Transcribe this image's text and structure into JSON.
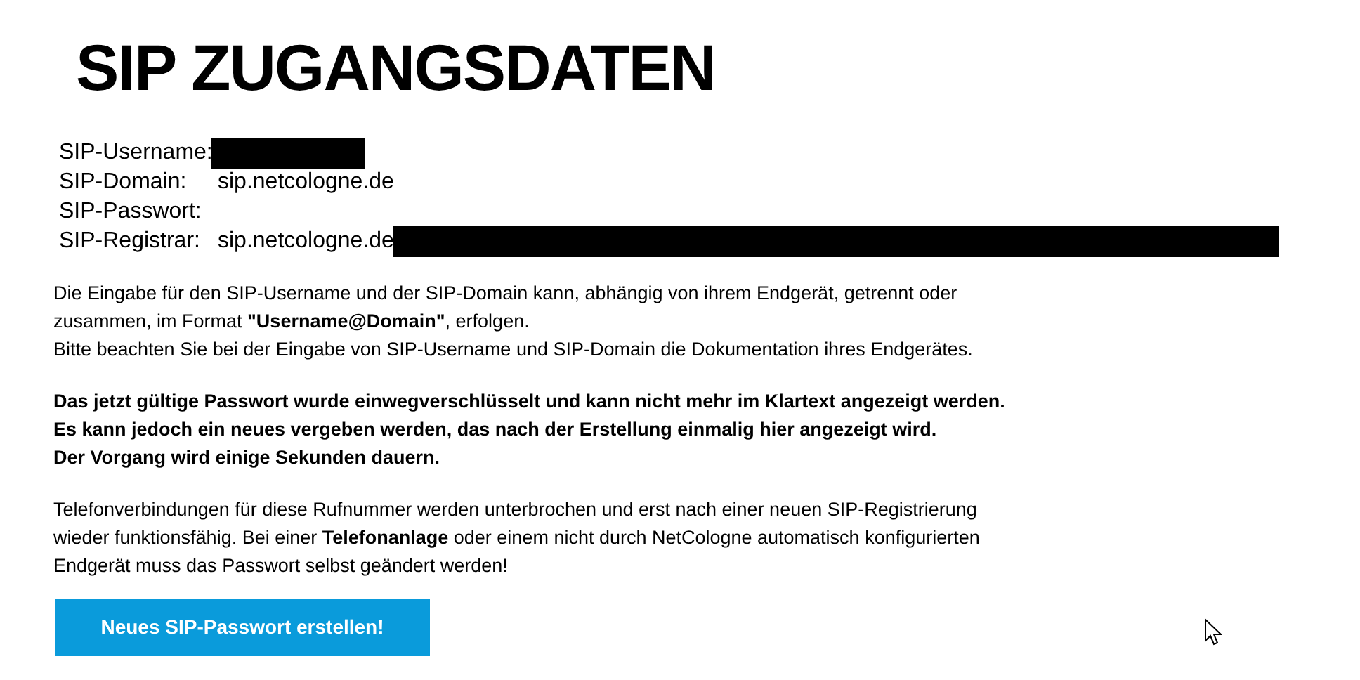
{
  "title": "SIP ZUGANGSDATEN",
  "fields": [
    {
      "label": "SIP-Username:",
      "redacted": true
    },
    {
      "label": "SIP-Domain:",
      "value": "sip.netcologne.de",
      "redacted": false
    },
    {
      "label": "SIP-Passwort:",
      "redacted": false
    },
    {
      "label": "SIP-Registrar:",
      "value": "sip.netcologne.de",
      "redacted": true
    }
  ],
  "paragraphs": [
    {
      "kind": "normal",
      "lines": [
        "Die Eingabe für den SIP-Username und der SIP-Domain kann, abhängig von ihrem Endgerät, getrennt oder zusammen, im Format **\"Username@Domain\"**, erfolgen.",
        "Bitte beachten Sie bei der Eingabe von SIP-Username und SIP-Domain die Dokumentation ihres Endgerätes."
      ]
    },
    {
      "kind": "bold",
      "lines": [
        "Das jetzt gültige Passwort wurde einwegverschlüsselt und kann nicht mehr im Klartext angezeigt werden.",
        "Es kann jedoch ein neues vergeben werden, das nach der Erstellung einmalig hier angezeigt wird.",
        "Der Vorgang wird einige Sekunden dauern."
      ]
    },
    {
      "kind": "normal",
      "lines": [
        "Telefonverbindungen für diese Rufnummer werden unterbrochen und erst nach einer neuen SIP-Registrierung wieder funktionsfähig. Bei einer **Telefonanlage** oder einem nicht durch NetCologne automatisch konfigurierten Endgerät muss das Passwort selbst geändert werden!"
      ]
    }
  ],
  "button": {
    "label": "Neues SIP-Passwort erstellen!"
  }
}
